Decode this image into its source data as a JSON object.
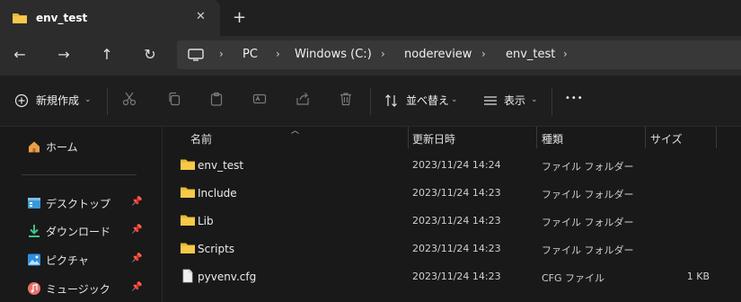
{
  "tab": {
    "title": "env_test",
    "close_icon": "✕",
    "new_tab_icon": "+"
  },
  "breadcrumb": [
    "PC",
    "Windows (C:)",
    "nodereview",
    "env_test"
  ],
  "commands": {
    "new_label": "新規作成",
    "sort_label": "並べ替え",
    "view_label": "表示",
    "more_label": "•••"
  },
  "sidebar": {
    "items": [
      {
        "label": "ホーム",
        "icon": "home-icon",
        "pinned": false
      },
      {
        "label": "デスクトップ",
        "icon": "desktop-icon",
        "pinned": true
      },
      {
        "label": "ダウンロード",
        "icon": "download-icon",
        "pinned": true
      },
      {
        "label": "ピクチャ",
        "icon": "pictures-icon",
        "pinned": true
      },
      {
        "label": "ミュージック",
        "icon": "music-icon",
        "pinned": true
      }
    ]
  },
  "columns": {
    "name": "名前",
    "modified": "更新日時",
    "type": "種類",
    "size": "サイズ"
  },
  "files": [
    {
      "name": "env_test",
      "modified": "2023/11/24 14:24",
      "type": "ファイル フォルダー",
      "size": "",
      "icon": "folder-icon"
    },
    {
      "name": "Include",
      "modified": "2023/11/24 14:23",
      "type": "ファイル フォルダー",
      "size": "",
      "icon": "folder-icon"
    },
    {
      "name": "Lib",
      "modified": "2023/11/24 14:23",
      "type": "ファイル フォルダー",
      "size": "",
      "icon": "folder-icon"
    },
    {
      "name": "Scripts",
      "modified": "2023/11/24 14:23",
      "type": "ファイル フォルダー",
      "size": "",
      "icon": "folder-icon"
    },
    {
      "name": "pyvenv.cfg",
      "modified": "2023/11/24 14:23",
      "type": "CFG ファイル",
      "size": "1 KB",
      "icon": "file-icon"
    }
  ],
  "colors": {
    "folder": "#e9b739",
    "accent": "#5aa0e6",
    "background": "#191919"
  }
}
